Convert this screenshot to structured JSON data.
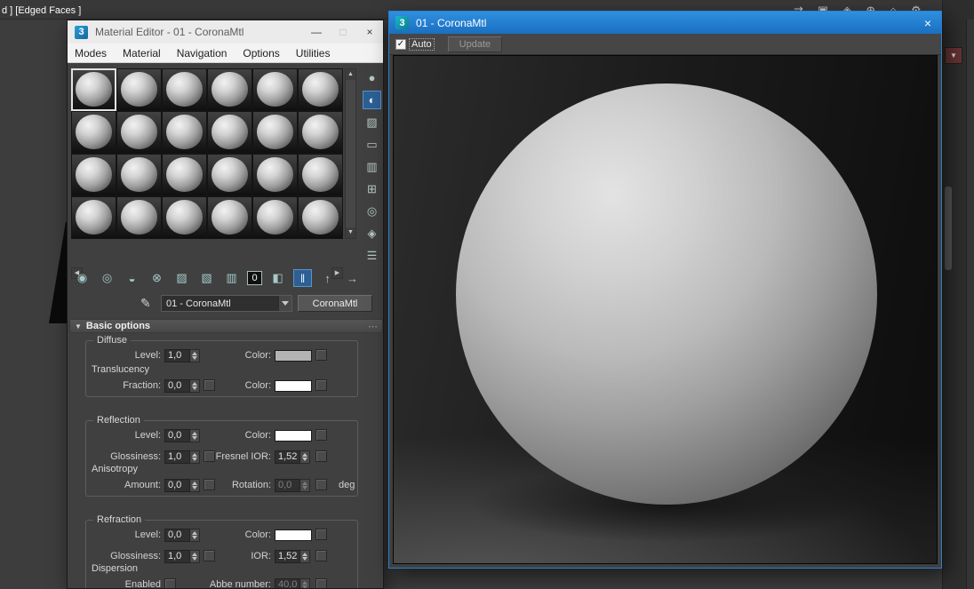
{
  "desktop": {
    "viewport_label": "d ] [Edged Faces ]"
  },
  "main_toolbar": {
    "icons": [
      {
        "name": "mirror",
        "glyph": "⇄"
      },
      {
        "name": "align",
        "glyph": "▣"
      },
      {
        "name": "layer-manager",
        "glyph": "◈"
      },
      {
        "name": "curve-editor",
        "glyph": "⊕"
      },
      {
        "name": "schematic-view",
        "glyph": "⌂"
      },
      {
        "name": "utilities",
        "glyph": "⚙"
      }
    ]
  },
  "right_panel": {
    "preset_button_glyph": "▼"
  },
  "material_editor": {
    "icon_text": "3",
    "title": "Material Editor - 01 - CoronaMtl",
    "window_controls": {
      "minimize": "—",
      "maximize": "□",
      "close": "×"
    },
    "menus": [
      "Modes",
      "Material",
      "Navigation",
      "Options",
      "Utilities"
    ],
    "sample_slots": {
      "rows": 4,
      "cols": 6,
      "active_index": 0
    },
    "scroll": {
      "up_glyph": "▲",
      "down_glyph": "▼",
      "left_glyph": "◀",
      "right_glyph": "▶"
    },
    "side_tools": [
      {
        "name": "sample-type",
        "glyph": "●"
      },
      {
        "name": "backlight",
        "glyph": "◐"
      },
      {
        "name": "background",
        "glyph": "▨"
      },
      {
        "name": "sample-uv-tiling",
        "glyph": "▭"
      },
      {
        "name": "video-color-check",
        "glyph": "▥"
      },
      {
        "name": "generate-preview",
        "glyph": "⊞"
      },
      {
        "name": "options",
        "glyph": "◎"
      },
      {
        "name": "select-by-material",
        "glyph": "◈"
      },
      {
        "name": "material-map-navigator",
        "glyph": "☰"
      }
    ],
    "toolbar": [
      {
        "name": "get-material",
        "glyph": "◉"
      },
      {
        "name": "put-material-to-scene",
        "glyph": "◎"
      },
      {
        "name": "assign-material-to-selection",
        "glyph": "◒"
      },
      {
        "name": "reset-map",
        "glyph": "⊗"
      },
      {
        "name": "make-material-copy",
        "glyph": "▨"
      },
      {
        "name": "make-unique",
        "glyph": "▧"
      },
      {
        "name": "put-to-library",
        "glyph": "▥"
      },
      {
        "name": "material-id-channel",
        "glyph": "0"
      },
      {
        "name": "show-material-in-viewport",
        "glyph": "◧"
      },
      {
        "name": "show-end-result",
        "glyph": "‖"
      },
      {
        "name": "go-to-parent",
        "glyph": "↑"
      },
      {
        "name": "go-forward-to-sibling",
        "glyph": "→"
      }
    ],
    "name_row": {
      "eyedropper": "✎",
      "material_name": "01 - CoronaMtl",
      "type_button": "CoronaMtl"
    },
    "rollout": {
      "collapse_glyph": "▼",
      "title": "Basic options",
      "grip_glyph": "⋯"
    },
    "basic_options": {
      "diffuse": {
        "title": "Diffuse",
        "level_label": "Level:",
        "level_value": "1,0",
        "color_label": "Color:",
        "color_value": "#b3b3b3"
      },
      "translucency": {
        "title": "Translucency",
        "fraction_label": "Fraction:",
        "fraction_value": "0,0",
        "color_label": "Color:",
        "color_value": "#ffffff"
      },
      "reflection": {
        "title": "Reflection",
        "level_label": "Level:",
        "level_value": "0,0",
        "color_label": "Color:",
        "color_value": "#ffffff",
        "glossiness_label": "Glossiness:",
        "glossiness_value": "1,0",
        "fresnel_label": "Fresnel IOR:",
        "fresnel_value": "1,52",
        "anisotropy_title": "Anisotropy",
        "amount_label": "Amount:",
        "amount_value": "0,0",
        "rotation_label": "Rotation:",
        "rotation_value": "0,0",
        "deg_label": "deg"
      },
      "refraction": {
        "title": "Refraction",
        "level_label": "Level:",
        "level_value": "0,0",
        "color_label": "Color:",
        "color_value": "#ffffff",
        "glossiness_label": "Glossiness:",
        "glossiness_value": "1,0",
        "ior_label": "IOR:",
        "ior_value": "1,52",
        "dispersion_title": "Dispersion",
        "enabled_label": "Enabled",
        "abbe_label": "Abbe number:",
        "abbe_value": "40,0"
      }
    }
  },
  "corona_frame_buffer": {
    "icon_text": "3",
    "title": "01 - CoronaMtl",
    "close": "×",
    "auto_label": "Auto",
    "auto_checked": true,
    "check_glyph": "✓",
    "update_label": "Update"
  }
}
